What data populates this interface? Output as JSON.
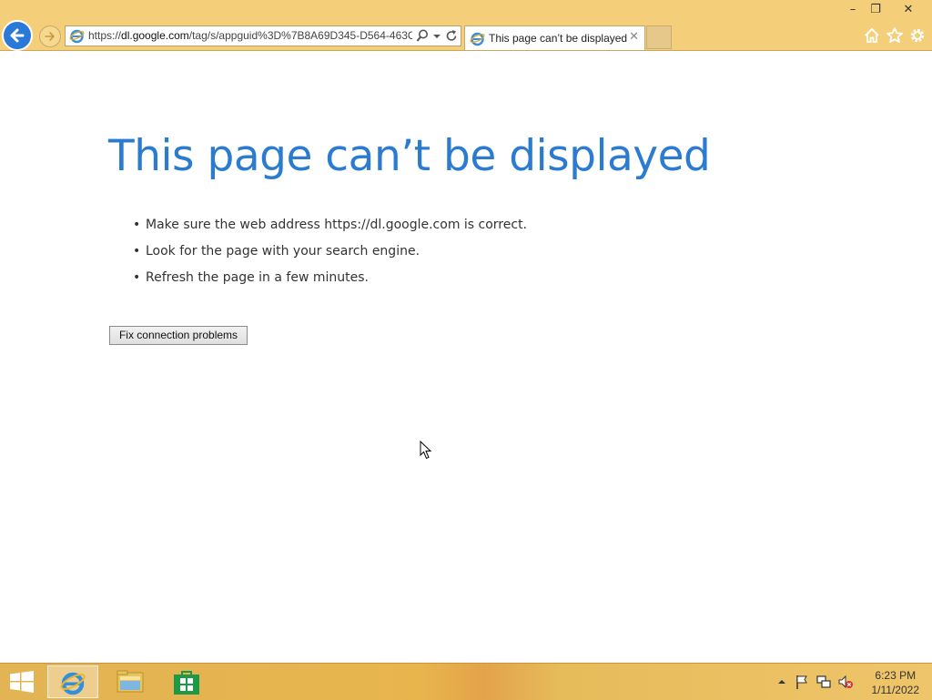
{
  "window": {
    "minimize_glyph": "–",
    "restore_glyph": "❐",
    "close_glyph": "✕"
  },
  "browser": {
    "address": {
      "scheme": "https://",
      "host": "dl.google.com",
      "path": "/tag/s/appguid%3D%7B8A69D345-D564-463C"
    },
    "tab": {
      "title": "This page can’t be displayed",
      "close_glyph": "✕"
    }
  },
  "page": {
    "title": "This page can’t be displayed",
    "tips": [
      "Make sure the web address https://dl.google.com is correct.",
      "Look for the page with your search engine.",
      "Refresh the page in a few minutes."
    ],
    "fix_button": "Fix connection problems"
  },
  "taskbar": {
    "items": [
      "internet-explorer",
      "file-explorer",
      "store"
    ],
    "clock": {
      "time": "6:23 PM",
      "date": "1/11/2022"
    }
  },
  "colors": {
    "chrome": "#f4ce78",
    "accent_blue": "#2b7bd1",
    "back_button": "#2a79d6"
  }
}
